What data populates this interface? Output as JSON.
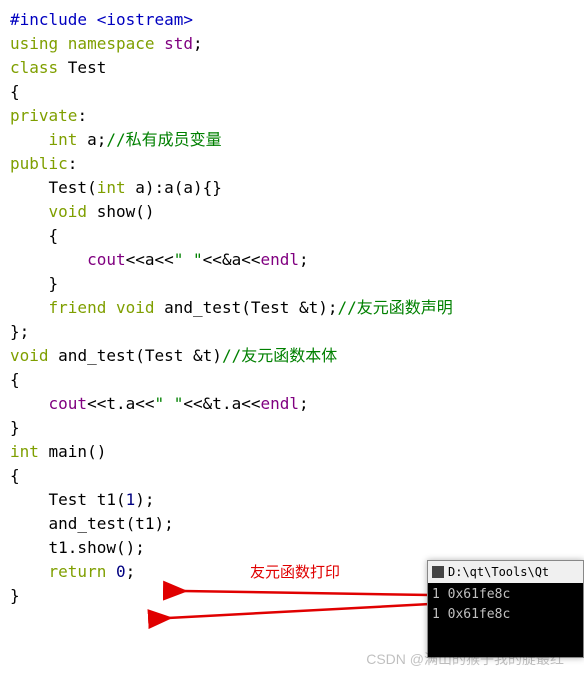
{
  "code": {
    "l1_pp": "#include ",
    "l1_inc": "<iostream>",
    "l2_kw1": "using ",
    "l2_kw2": "namespace ",
    "l2_id": "std",
    "l2_pun": ";",
    "l3_kw": "class ",
    "l3_id": "Test",
    "l4": "{",
    "l5_kw": "private",
    "l5_pun": ":",
    "l6_pad": "    ",
    "l6_kw": "int ",
    "l6_id": "a",
    "l6_pun": ";",
    "l6_cm": "//私有成员变量",
    "l7_kw": "public",
    "l7_pun": ":",
    "l8_pad": "    ",
    "l8_id": "Test",
    "l8_sig": "(",
    "l8_kw": "int ",
    "l8_arg": "a):a(a){}",
    "l9_pad": "    ",
    "l9_kw": "void ",
    "l9_fn": "show()",
    "l10": "    {",
    "l11_pad": "        ",
    "l11_cout": "cout",
    "l11_a": "<<a<<",
    "l11_str": "\" \"",
    "l11_b": "<<&a<<",
    "l11_endl": "endl",
    "l11_pun": ";",
    "l12": "    }",
    "l13_pad": "    ",
    "l13_kw1": "friend ",
    "l13_kw2": "void ",
    "l13_fn": "and_test(Test &t);",
    "l13_cm": "//友元函数声明",
    "l14": "};",
    "l15_kw": "void ",
    "l15_fn": "and_test(Test &t)",
    "l15_cm": "//友元函数本体",
    "l16": "{",
    "l17_pad": "    ",
    "l17_cout": "cout",
    "l17_a": "<<t.a<<",
    "l17_str": "\" \"",
    "l17_b": "<<&t.a<<",
    "l17_endl": "endl",
    "l17_pun": ";",
    "l18": "}",
    "l19_kw": "int ",
    "l19_fn": "main()",
    "l20": "{",
    "l21_pad": "    ",
    "l21_txt": "Test t1(",
    "l21_num": "1",
    "l21_end": ");",
    "l22_pad": "    ",
    "l22_txt": "and_test(t1);",
    "l23_pad": "    ",
    "l23_txt": "t1.show();",
    "l24_pad": "    ",
    "l24_kw": "return ",
    "l24_num": "0",
    "l24_pun": ";",
    "l25": "}"
  },
  "annotation": "友元函数打印",
  "console": {
    "title": "D:\\qt\\Tools\\Qt",
    "line1": "1 0x61fe8c",
    "line2": "1 0x61fe8c"
  },
  "watermark": "CSDN @满山的猴子我的腚最红"
}
